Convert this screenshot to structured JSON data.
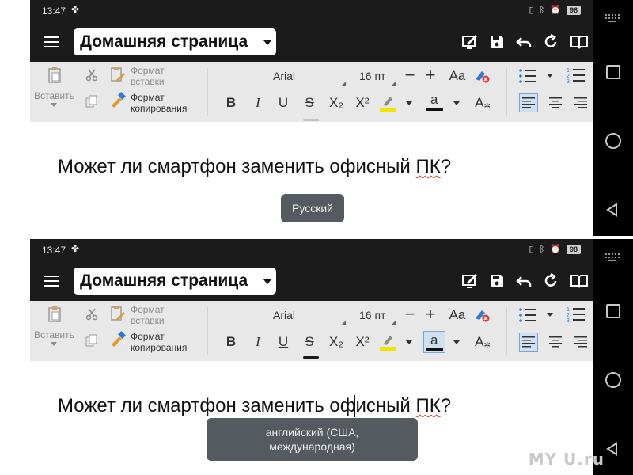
{
  "status": {
    "time": "13:47",
    "battery": "98"
  },
  "titlebar": {
    "title": "Домашняя страница"
  },
  "ribbon": {
    "paste_label": "Вставить",
    "format_paste_label_1": "Формат",
    "format_paste_label_2": "вставки",
    "format_copy_label_1": "Формат",
    "format_copy_label_2": "копирования",
    "font_name": "Arial",
    "font_size": "16 пт",
    "minus": "−",
    "plus": "+",
    "case_label": "Aa",
    "bold": "B",
    "italic": "I",
    "underline": "U",
    "strike": "S",
    "subscript": "X₂",
    "superscript": "X²",
    "font_color_label": "a",
    "char_style_label": "A"
  },
  "document": {
    "text_before": "Может ли смартфон заменить офисный ",
    "text_misspelled": "ПК",
    "text_after": "?"
  },
  "panels": {
    "top": {
      "toast": "Русский"
    },
    "bottom": {
      "toast_line1": "английский (США,",
      "toast_line2": "международная)"
    }
  },
  "watermark": "MY   U.ru",
  "colors": {
    "highlight_yellow": "#f5e400",
    "accent_blue": "#2f7ad6",
    "clear_format_red": "#e53935"
  }
}
